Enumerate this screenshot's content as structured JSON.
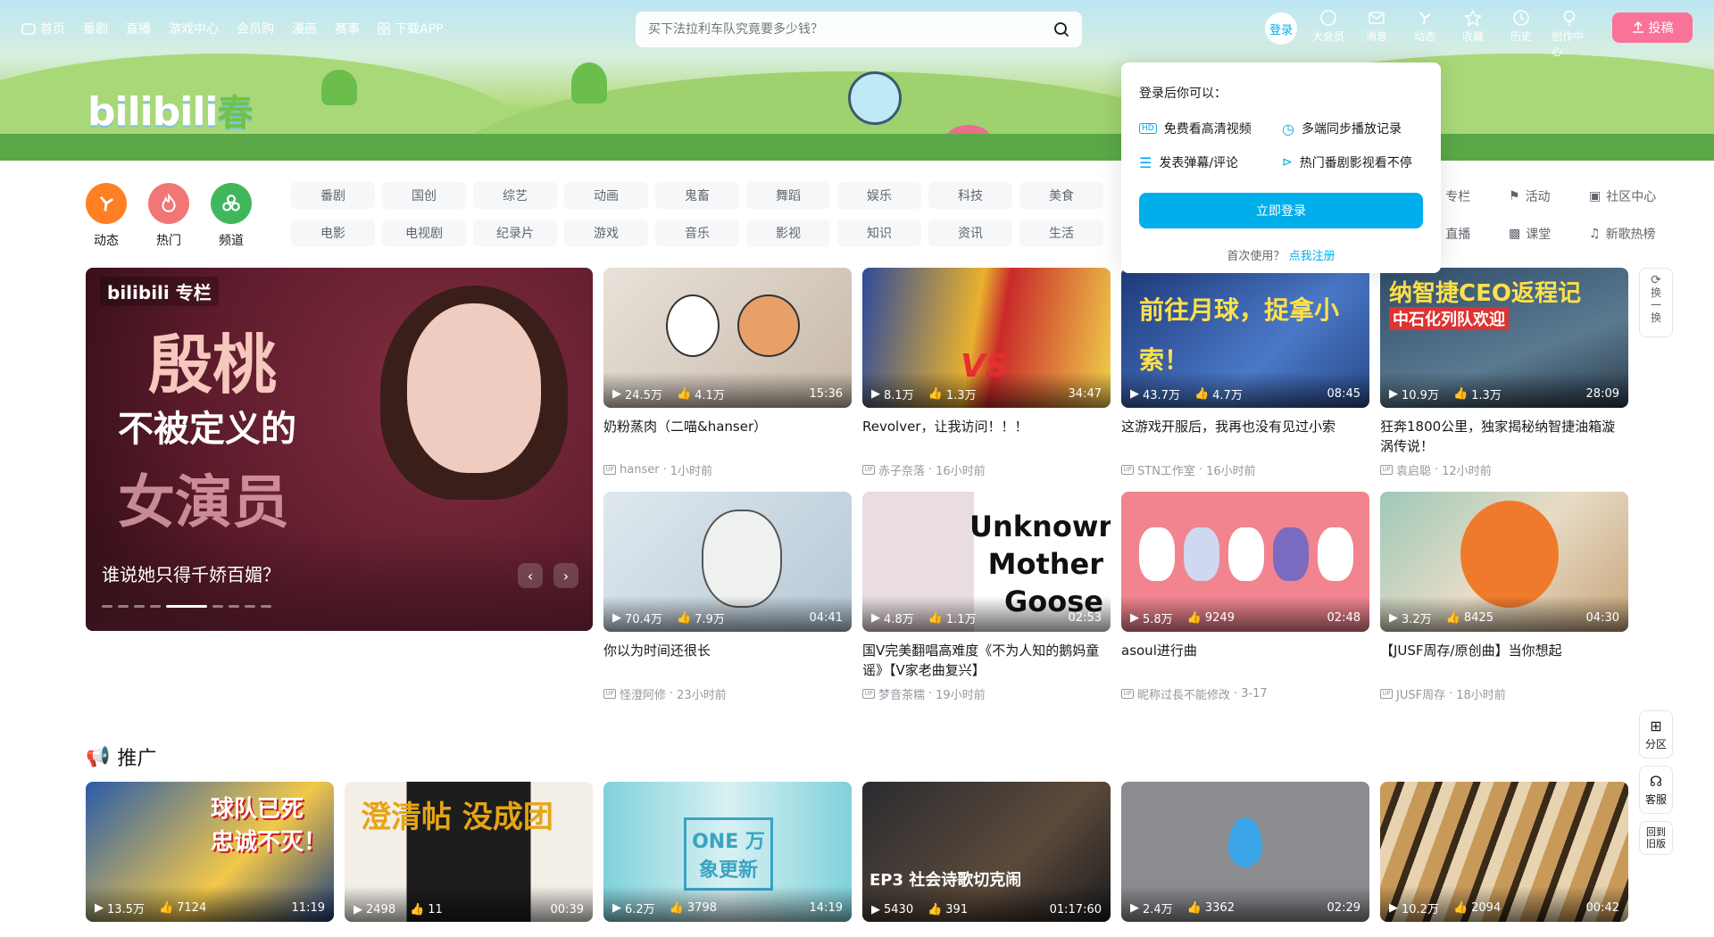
{
  "topnav": {
    "items": [
      "首页",
      "番剧",
      "直播",
      "游戏中心",
      "会员购",
      "漫画",
      "赛事",
      "下载APP"
    ]
  },
  "search": {
    "placeholder": "买下法拉利车队究竟要多少钱？"
  },
  "user": {
    "login_label": "登录",
    "upload_label": "投稿"
  },
  "right_icons": [
    {
      "label": "大会员",
      "icon": "vip-icon"
    },
    {
      "label": "消息",
      "icon": "message-icon"
    },
    {
      "label": "动态",
      "icon": "dynamic-icon"
    },
    {
      "label": "收藏",
      "icon": "star-icon"
    },
    {
      "label": "历史",
      "icon": "history-icon"
    },
    {
      "label": "创作中心",
      "icon": "lightbulb-icon"
    }
  ],
  "logo": {
    "text": "bilibili",
    "season": "春"
  },
  "channels": [
    {
      "label": "动态",
      "color": "#ff7f24"
    },
    {
      "label": "热门",
      "color": "#f07775"
    },
    {
      "label": "频道",
      "color": "#40b75d"
    }
  ],
  "categories": [
    "番剧",
    "国创",
    "综艺",
    "动画",
    "鬼畜",
    "舞蹈",
    "娱乐",
    "科技",
    "美食",
    "电影",
    "电视剧",
    "纪录片",
    "游戏",
    "音乐",
    "影视",
    "知识",
    "资讯",
    "生活"
  ],
  "extra_links": [
    "专栏",
    "活动",
    "社区中心",
    "直播",
    "课堂",
    "新歌热榜"
  ],
  "banner": {
    "tag": "bilibili 专栏",
    "line1": "殷桃",
    "line2": "不被定义的",
    "line3": "女演员",
    "caption": "谁说她只得千娇百媚？",
    "prev": "‹",
    "next": "›"
  },
  "videos": [
    {
      "views": "24.5万",
      "likes": "4.1万",
      "duration": "15:36",
      "title": "奶粉蒸肉（二喵&hanser）",
      "author": "hanser",
      "time": "1小时前"
    },
    {
      "views": "8.1万",
      "likes": "1.3万",
      "duration": "34:47",
      "title": "Revolver，让我访问！！！",
      "author": "赤子奈落",
      "time": "16小时前"
    },
    {
      "views": "43.7万",
      "likes": "4.7万",
      "duration": "08:45",
      "title": "这游戏开服后，我再也没有见过小索",
      "author": "STN工作室",
      "time": "16小时前"
    },
    {
      "views": "10.9万",
      "likes": "1.3万",
      "duration": "28:09",
      "title": "狂奔1800公里，独家揭秘纳智捷油箱漩涡传说！",
      "author": "袁启聪",
      "time": "12小时前"
    },
    {
      "views": "70.4万",
      "likes": "7.9万",
      "duration": "04:41",
      "title": "你以为时间还很长",
      "author": "怪澄阿修",
      "time": "23小时前"
    },
    {
      "views": "4.8万",
      "likes": "1.1万",
      "duration": "02:53",
      "title": "国V完美翻唱高难度《不为人知的鹅妈童谣》【V家老曲复兴】",
      "author": "梦音茶糯",
      "time": "19小时前"
    },
    {
      "views": "5.8万",
      "likes": "9249",
      "duration": "02:48",
      "title": "asoul进行曲",
      "author": "昵称过長不能修改",
      "time": "3-17"
    },
    {
      "views": "3.2万",
      "likes": "8425",
      "duration": "04:30",
      "title": "【JUSF周存/原创曲】当你想起",
      "author": "JUSF周存",
      "time": "18小时前"
    }
  ],
  "thumb_text": {
    "v3": "前往月球，捉拿小索！",
    "v4": "纳智捷CEO返程记",
    "v4b": "中石化列队欢迎",
    "v6a": "Unknown",
    "v6b": "Mother",
    "v6c": "Goose",
    "v2": "VS"
  },
  "side": {
    "refresh": "换一换",
    "zone": "分区",
    "service": "客服",
    "old": "回到旧版"
  },
  "promo": {
    "title": "推广"
  },
  "promo_videos": [
    {
      "views": "13.5万",
      "likes": "7124",
      "duration": "11:19",
      "text": "球队已死 忠诚不灭！"
    },
    {
      "views": "2498",
      "likes": "11",
      "duration": "00:39",
      "text": "澄清帖 没成团"
    },
    {
      "views": "6.2万",
      "likes": "3798",
      "duration": "14:19",
      "text": "ONE 万象更新"
    },
    {
      "views": "5430",
      "likes": "391",
      "duration": "01:17:60",
      "text": "EP3 社会诗歌切克闹"
    },
    {
      "views": "2.4万",
      "likes": "3362",
      "duration": "02:29",
      "text": ""
    },
    {
      "views": "10.2万",
      "likes": "2094",
      "duration": "00:42",
      "text": ""
    }
  ],
  "login_popup": {
    "heading": "登录后你可以：",
    "features": [
      "免费看高清视频",
      "多端同步播放记录",
      "发表弹幕/评论",
      "热门番剧影视看不停"
    ],
    "button": "立即登录",
    "first_use": "首次使用？",
    "register": "点我注册"
  }
}
